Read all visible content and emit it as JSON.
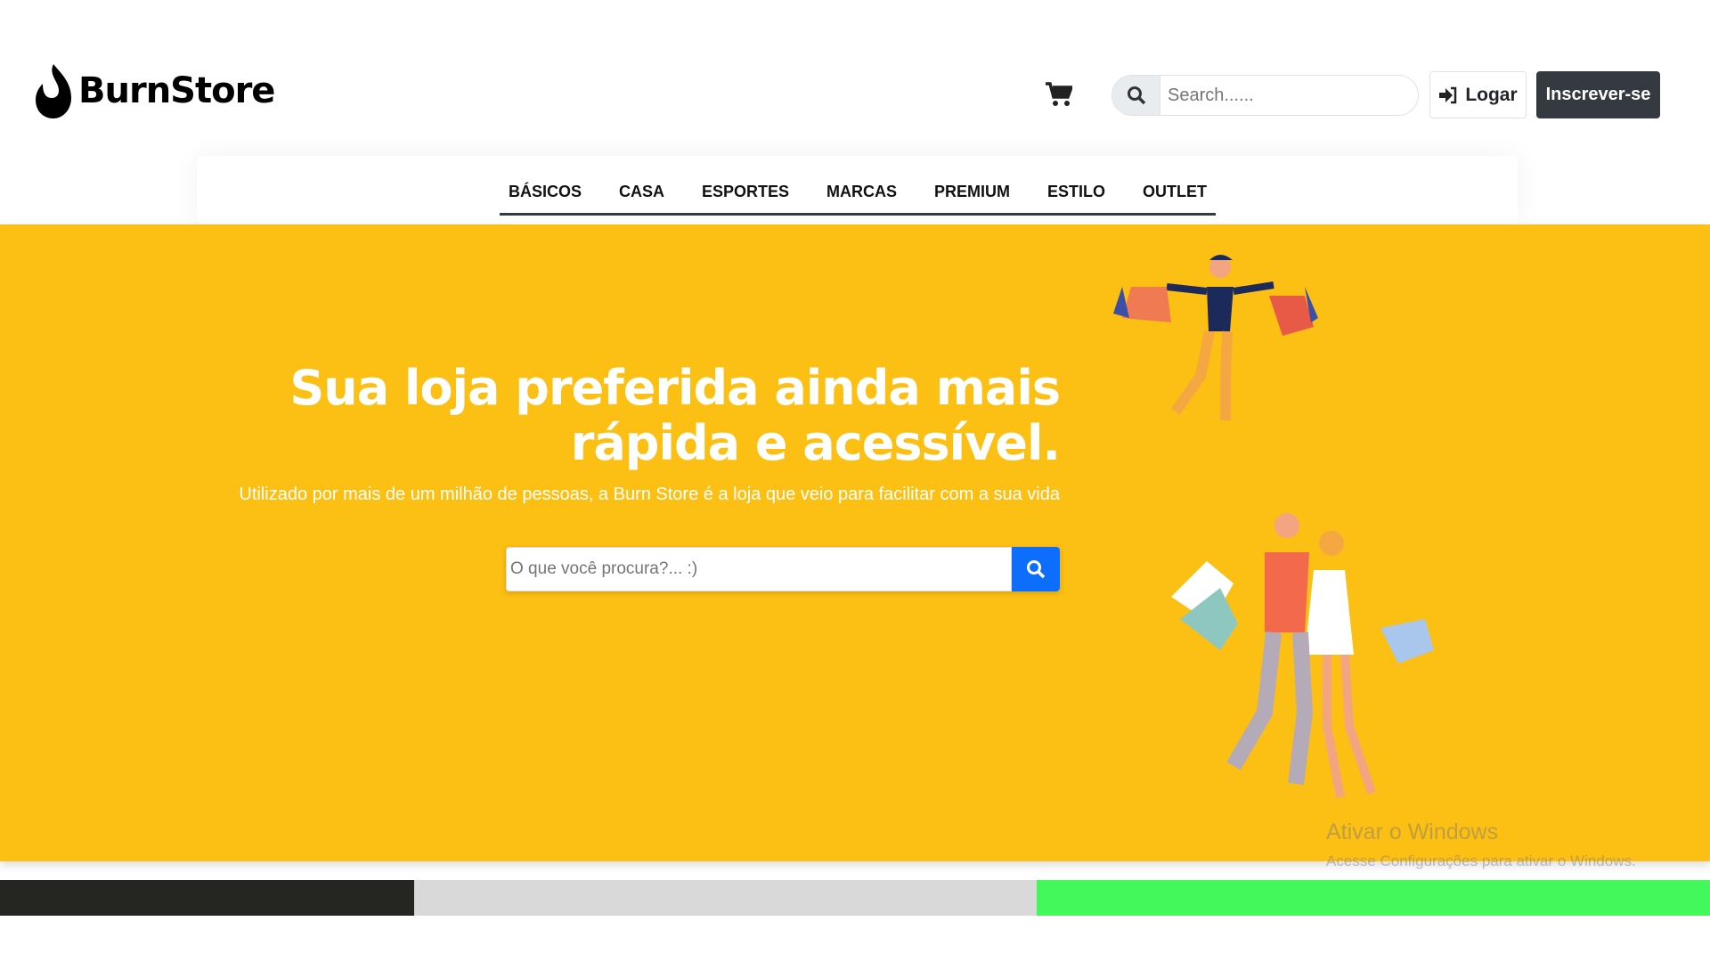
{
  "brand": {
    "name": "BurnStore"
  },
  "header": {
    "search_placeholder": "Search......",
    "login_label": "Logar",
    "signup_label": "Inscrever-se"
  },
  "nav": {
    "items": [
      "BÁSICOS",
      "CASA",
      "ESPORTES",
      "MARCAS",
      "PREMIUM",
      "ESTILO",
      "OUTLET"
    ]
  },
  "hero": {
    "title": "Sua loja preferida ainda mais rápida e acessível.",
    "subtitle": "Utilizado por mais de um milhão de pessoas, a Burn Store é a loja que veio para facilitar com a sua vida",
    "search_placeholder": "O que você procura?... :)"
  },
  "watermark": {
    "title": "Ativar o Windows",
    "text": "Acesse Configurações para ativar o Windows."
  },
  "colors": {
    "hero": "#fcbf13",
    "primary": "#0d6efd",
    "dark": "#343a40",
    "bar_dark": "#252621",
    "bar_gray": "#d9d9d9",
    "bar_green": "#42f85a"
  }
}
